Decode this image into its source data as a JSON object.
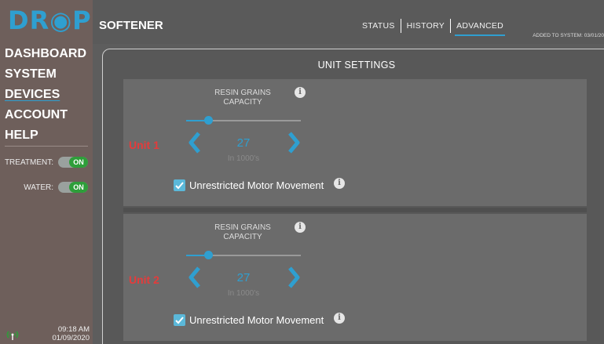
{
  "logo": "DR◉P",
  "nav": [
    "DASHBOARD",
    "SYSTEM",
    "DEVICES",
    "ACCOUNT",
    "HELP"
  ],
  "toggles": {
    "treatment_label": "TREATMENT:",
    "treatment_state": "ON",
    "water_label": "WATER:",
    "water_state": "ON"
  },
  "status": {
    "time": "09:18 AM",
    "date": "01/09/2020"
  },
  "header": {
    "title": "SOFTENER",
    "tabs": [
      "STATUS",
      "HISTORY",
      "ADVANCED"
    ],
    "active_tab": "ADVANCED",
    "added": "ADDED TO SYSTEM: 03/01/20"
  },
  "panel": {
    "title": "UNIT SETTINGS"
  },
  "units": [
    {
      "label": "Unit 1",
      "resin_label_line1": "RESIN GRAINS",
      "resin_label_line2": "CAPACITY",
      "value": "27",
      "subunit": "In 1000's",
      "slider_fraction": 0.19,
      "checkbox_label": "Unrestricted Motor Movement",
      "checked": true
    },
    {
      "label": "Unit 2",
      "resin_label_line1": "RESIN GRAINS",
      "resin_label_line2": "CAPACITY",
      "value": "27",
      "subunit": "In 1000's",
      "slider_fraction": 0.19,
      "checkbox_label": "Unrestricted Motor Movement",
      "checked": true
    }
  ],
  "colors": {
    "accent": "#2f9fd0",
    "unit_label": "#e53b3b",
    "toggle_on": "#2e9e3a"
  },
  "info_icon_glyph": "i"
}
